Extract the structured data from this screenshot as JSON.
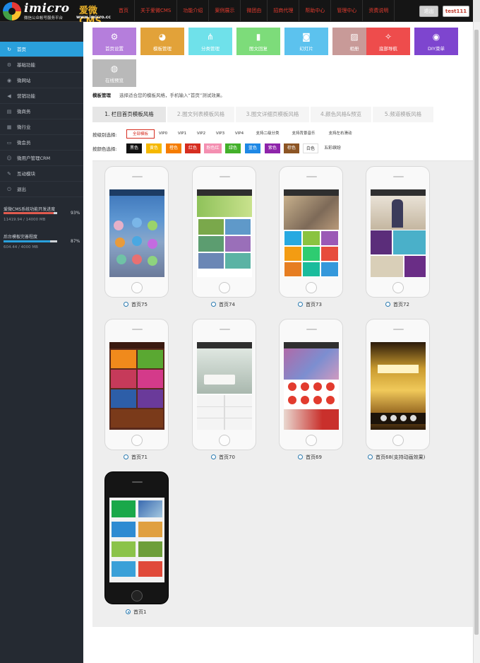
{
  "header": {
    "brand": "imicro",
    "brand_cn": "爱微CMS",
    "tagline": "微信公众帐号服务平台",
    "url": "www.imicro.cc",
    "nav": [
      "首页",
      "关于爱微CMS",
      "功能介绍",
      "案例展示",
      "微团由",
      "招商代理",
      "帮助中心",
      "管理中心",
      "资费说明"
    ],
    "logout_label": "退出",
    "user_label": "test111"
  },
  "sidebar": {
    "items": [
      {
        "label": "首页",
        "icon": "refresh-icon",
        "active": true
      },
      {
        "label": "基础功能",
        "icon": "gear-icon",
        "active": false
      },
      {
        "label": "微网站",
        "icon": "globe-icon",
        "active": false
      },
      {
        "label": "营销功能",
        "icon": "megaphone-icon",
        "active": false
      },
      {
        "label": "微商务",
        "icon": "cart-icon",
        "active": false
      },
      {
        "label": "微行业",
        "icon": "briefcase-icon",
        "active": false
      },
      {
        "label": "微会员",
        "icon": "card-icon",
        "active": false
      },
      {
        "label": "微用户管理CRM",
        "icon": "users-icon",
        "active": false
      },
      {
        "label": "互动模块",
        "icon": "chat-icon",
        "active": false
      },
      {
        "label": "退出",
        "icon": "power-icon",
        "active": false
      }
    ],
    "progress": [
      {
        "label": "爱微CMS系统功能开发进度",
        "percent_label": "93%",
        "value_text": "11419.94 / 14000 MB",
        "fill": 0.93,
        "color": "#e05a4e"
      },
      {
        "label": "后台模板完善程度",
        "percent_label": "87%",
        "value_text": "604.44 / 4000 MB",
        "fill": 0.87,
        "color": "#2aa0dc"
      }
    ]
  },
  "tiles": [
    {
      "label": "首页设置",
      "icon": "gear-icon",
      "color": "#b57edc"
    },
    {
      "label": "模板管理",
      "icon": "palette-icon",
      "color": "#e2a239"
    },
    {
      "label": "分类管理",
      "icon": "share-icon",
      "color": "#6fe1ea"
    },
    {
      "label": "图文回复",
      "icon": "book-icon",
      "color": "#7ddc7a"
    },
    {
      "label": "幻灯片",
      "icon": "camera-icon",
      "color": "#5cc2ee"
    },
    {
      "label": "相册",
      "icon": "image-icon",
      "color": "#c89a98"
    },
    {
      "label": "底部导航",
      "icon": "wand-icon",
      "color": "#ee4c4c"
    },
    {
      "label": "DIY菜单",
      "icon": "eye-icon",
      "color": "#7e45cf"
    },
    {
      "label": "在线预览",
      "icon": "globe-icon",
      "color": "#b9b9b9"
    }
  ],
  "section": {
    "title": "模板管理",
    "description": "选择适合您的模板风格，手机输入“首页”测试效果。"
  },
  "tabs": [
    {
      "label": "1. 栏目首页模板风格",
      "active": true
    },
    {
      "label": "2.图文列表模板风格",
      "active": false
    },
    {
      "label": "3.图文详细页模板风格",
      "active": false
    },
    {
      "label": "4.颜色风格&预览",
      "active": false
    },
    {
      "label": "5.频道模板风格",
      "active": false
    }
  ],
  "filter_level": {
    "label": "按级别选择:",
    "options": [
      {
        "label": "全部模板",
        "selected": true
      },
      {
        "label": "VIP0",
        "selected": false
      },
      {
        "label": "VIP1",
        "selected": false
      },
      {
        "label": "VIP2",
        "selected": false
      },
      {
        "label": "VIP3",
        "selected": false
      },
      {
        "label": "VIP4",
        "selected": false
      },
      {
        "label": "支持二级分类",
        "selected": false
      },
      {
        "label": "支持背景音乐",
        "selected": false
      },
      {
        "label": "支持左右滑动",
        "selected": false
      }
    ]
  },
  "filter_color": {
    "label": "按颜色选择:",
    "options": [
      {
        "label": "黑色",
        "color": "#111111",
        "text": "#ffffff"
      },
      {
        "label": "黄色",
        "color": "#f5b800",
        "text": "#ffffff"
      },
      {
        "label": "橙色",
        "color": "#f57c00",
        "text": "#ffffff"
      },
      {
        "label": "红色",
        "color": "#d62d20",
        "text": "#ffffff"
      },
      {
        "label": "粉色红",
        "color": "#f48fb1",
        "text": "#ffffff"
      },
      {
        "label": "绿色",
        "color": "#43b02a",
        "text": "#ffffff"
      },
      {
        "label": "蓝色",
        "color": "#1e88e5",
        "text": "#ffffff"
      },
      {
        "label": "紫色",
        "color": "#8e24aa",
        "text": "#ffffff"
      },
      {
        "label": "棕色",
        "color": "#8d5524",
        "text": "#ffffff"
      },
      {
        "label": "白色",
        "color": "#ffffff",
        "text": "#333333"
      },
      {
        "label": "五彩缤纷",
        "color": "#eeeeee",
        "text": "#333333"
      }
    ]
  },
  "templates": [
    {
      "name": "首页75",
      "theme": "blue-city",
      "checked": false
    },
    {
      "name": "首页74",
      "theme": "green-grid",
      "checked": false
    },
    {
      "name": "首页73",
      "theme": "colorful-metro",
      "checked": false
    },
    {
      "name": "首页72",
      "theme": "fashion",
      "checked": false
    },
    {
      "name": "首页71",
      "theme": "metro-brown",
      "checked": false
    },
    {
      "name": "首页70",
      "theme": "white-interior",
      "checked": false
    },
    {
      "name": "首页69",
      "theme": "serenity",
      "checked": false
    },
    {
      "name": "首页68(支持动画效果)",
      "theme": "gold-poster",
      "checked": false
    },
    {
      "name": "首页1",
      "theme": "green-iphone",
      "checked": true
    }
  ]
}
